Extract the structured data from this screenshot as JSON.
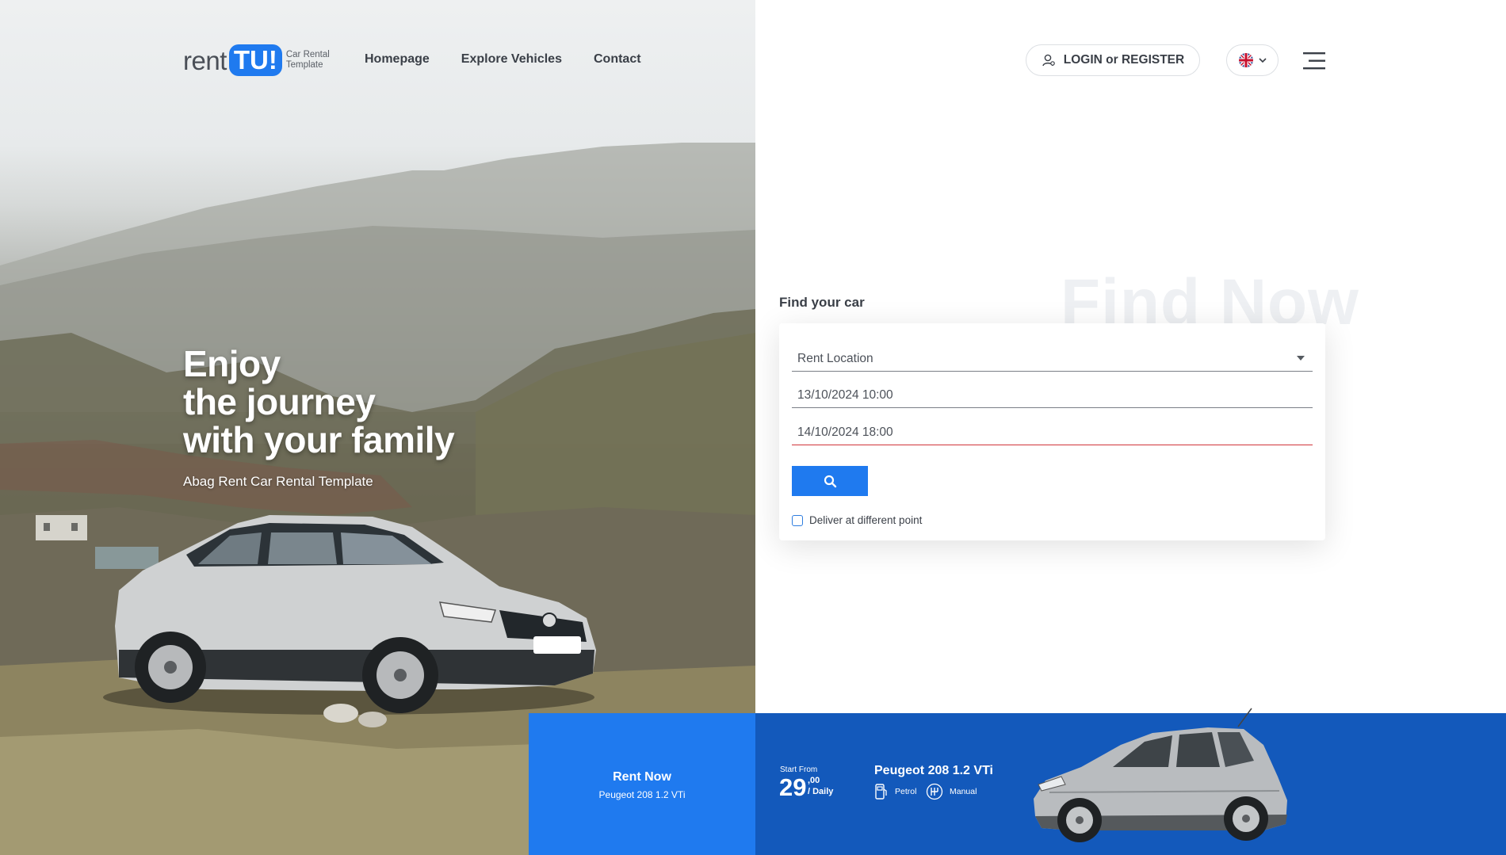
{
  "brand": {
    "name_part1": "rent",
    "name_part2": "TU!",
    "tagline_line1": "Car Rental",
    "tagline_line2": "Template",
    "accent_color": "#1f7aef"
  },
  "nav": {
    "items": [
      {
        "label": "Homepage"
      },
      {
        "label": "Explore Vehicles"
      },
      {
        "label": "Contact"
      }
    ]
  },
  "header": {
    "login_label": "LOGIN or REGISTER",
    "login_icon": "user-icon",
    "language_icon": "uk-flag-icon",
    "menu_icon": "hamburger-menu-icon"
  },
  "hero": {
    "title_lines": [
      "Enjoy",
      "the journey",
      "with your family"
    ],
    "subtitle": "Abag Rent Car Rental Template"
  },
  "search": {
    "background_word": "Find Now",
    "heading": "Find your car",
    "location_placeholder": "Rent Location",
    "pickup_datetime": "13/10/2024 10:00",
    "return_datetime": "14/10/2024 18:00",
    "search_icon": "search-icon",
    "different_point_label": "Deliver at different point",
    "different_point_checked": false,
    "error_color": "#d0343a"
  },
  "featured": {
    "rent_now_label": "Rent Now",
    "rent_now_car": "Peugeot 208 1.2 VTi",
    "start_from_label": "Start From",
    "price_integer": "29",
    "price_decimal": ",00",
    "price_period": "/ Daily",
    "car_name": "Peugeot 208 1.2 VTi",
    "fuel": "Petrol",
    "fuel_icon": "fuel-pump-icon",
    "transmission": "Manual",
    "transmission_icon": "gearbox-icon",
    "bar_color": "#1359bb"
  }
}
